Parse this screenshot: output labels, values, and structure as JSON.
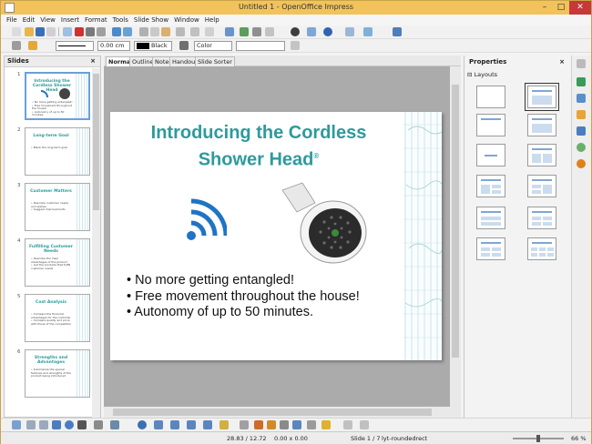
{
  "window": {
    "title": "Untitled 1 - OpenOffice Impress",
    "minimize": "–",
    "maximize": "□",
    "close": "✕"
  },
  "menu": [
    "File",
    "Edit",
    "View",
    "Insert",
    "Format",
    "Tools",
    "Slide Show",
    "Window",
    "Help"
  ],
  "line_toolbar": {
    "line_width": "0.00 cm",
    "line_color": "Black",
    "area_style": "Color",
    "area_color": ""
  },
  "slides_pane": {
    "title": "Slides",
    "close": "×",
    "slides": [
      {
        "number": "1",
        "title": "Introducing the Cordless Shower Head",
        "lines": [
          "• No more getting entangled!",
          "• Free movement throughout the house!",
          "• Autonomy of up to 50 minutes."
        ]
      },
      {
        "number": "2",
        "title": "Long-term Goal",
        "lines": [
          "• Blank the long-term goal"
        ]
      },
      {
        "number": "3",
        "title": "Customer Matters",
        "lines": [
          "• Describe customer needs and wishes",
          "• Suggest improvements"
        ]
      },
      {
        "number": "4",
        "title": "Fulfilling Customer Needs",
        "lines": [
          "• Describe the main advantages of the product",
          "• List the products that fulfill customer needs"
        ]
      },
      {
        "number": "5",
        "title": "Cost Analysis",
        "lines": [
          "• Compare the financial advantages for the customer",
          "• Compare quality and price with those of the competition"
        ]
      },
      {
        "number": "6",
        "title": "Strengths and Advantages",
        "lines": [
          "• Summarize the special features and strengths of the product being introduced"
        ]
      }
    ]
  },
  "view_tabs": [
    "Normal",
    "Outline",
    "Notes",
    "Handout",
    "Slide Sorter"
  ],
  "active_tab": "Normal",
  "slide": {
    "title_line1": "Introducing the Cordless",
    "title_line2": "Shower Head",
    "trademark": "®",
    "bullets": [
      "• No more getting entangled!",
      "• Free movement throughout the house!",
      "• Autonomy of up to 50 minutes."
    ]
  },
  "properties": {
    "title": "Properties",
    "close": "×",
    "section": "Layouts",
    "collapse": "⊟"
  },
  "status": {
    "position": "28.83 / 12.72",
    "size": "0.00 x 0.00",
    "slide": "Slide 1 / 7",
    "layout": "lyt-roundedrect",
    "zoom": "66 %"
  },
  "colors": {
    "titlebar": "#f1c35a",
    "accent": "#2e9a9c",
    "wifi": "#1f74c4"
  }
}
